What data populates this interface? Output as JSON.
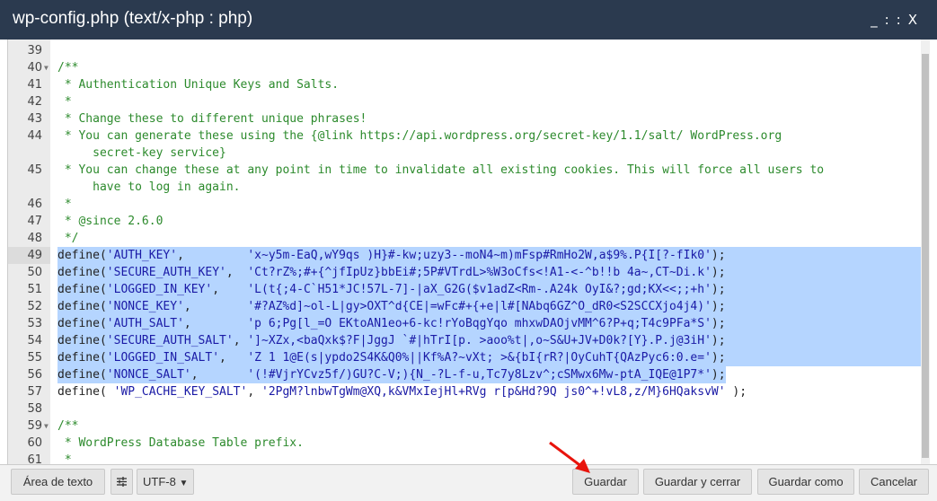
{
  "window": {
    "title": "wp-config.php (text/x-php : php)",
    "controls": [
      "_",
      "::",
      "X"
    ]
  },
  "editor": {
    "selected_lines": [
      49,
      50,
      51,
      52,
      53,
      54,
      55,
      56
    ],
    "current_line": 49,
    "lines": [
      {
        "n": 39,
        "text": ""
      },
      {
        "n": 40,
        "text": "/**",
        "fold": true,
        "comment": true
      },
      {
        "n": 41,
        "text": " * Authentication Unique Keys and Salts.",
        "comment": true
      },
      {
        "n": 42,
        "text": " *",
        "comment": true
      },
      {
        "n": 43,
        "text": " * Change these to different unique phrases!",
        "comment": true
      },
      {
        "n": 44,
        "text": " * You can generate these using the {@link https://api.wordpress.org/secret-key/1.1/salt/ WordPress.org",
        "cont": "     secret-key service}",
        "comment": true
      },
      {
        "n": 45,
        "text": " * You can change these at any point in time to invalidate all existing cookies. This will force all users to",
        "cont": "     have to log in again.",
        "comment": true
      },
      {
        "n": 46,
        "text": " *",
        "comment": true
      },
      {
        "n": 47,
        "text": " * @since 2.6.0",
        "comment": true
      },
      {
        "n": 48,
        "text": " */",
        "comment": true
      },
      {
        "n": 49,
        "text": "define('AUTH_KEY',         'x~y5m-EaQ,wY9qs )H}#-kw;uzy3--moN4~m)mFsp#RmHo2W,a$9%.P{I[?-fIk0');"
      },
      {
        "n": 50,
        "text": "define('SECURE_AUTH_KEY',  'Ct?rZ%;#+{^jfIpUz}bbEi#;5P#VTrdL>%W3oCfs<!A1-<-^b!!b 4a~,CT~Di.k');"
      },
      {
        "n": 51,
        "text": "define('LOGGED_IN_KEY',    'L(t{;4-C`H51*JC!57L-7]-|aX_G2G($v1adZ<Rm-.A24k OyI&?;gd;KX<<;;+h');"
      },
      {
        "n": 52,
        "text": "define('NONCE_KEY',        '#?AZ%d]~ol-L|gy>OXT^d{CE|=wFc#+{+e|l#[NAbq6GZ^O_dR0<S2SCCXjo4j4)');"
      },
      {
        "n": 53,
        "text": "define('AUTH_SALT',        'p 6;Pg[l_=O EKtoAN1eo+6-kc!rYoBqgYqo mhxwDAOjvMM^6?P+q;T4c9PFa*S');"
      },
      {
        "n": 54,
        "text": "define('SECURE_AUTH_SALT', ']~XZx,<baQxk$?F|JggJ `#|hTrI[p. >aoo%t|,o~S&U+JV+D0k?[Y}.P.j@3iH');"
      },
      {
        "n": 55,
        "text": "define('LOGGED_IN_SALT',   'Z 1 1@E(s|ypdo2S4K&Q0%||Kf%A?~vXt; >&{bI{rR?|OyCuhT{QAzPyc6:0.e=');"
      },
      {
        "n": 56,
        "text": "define('NONCE_SALT',       '(!#VjrYCvz5f/)GU?C-V;){N_-?L-f-u,Tc7y8Lzv^;cSMwx6Mw-ptA_IQE@1P7*');"
      },
      {
        "n": 57,
        "text": "define( 'WP_CACHE_KEY_SALT', '2PgM?lnbwTgWm@XQ,k&VMxIejHl+RVg r[p&Hd?9Q js0^+!vL8,z/M}6HQaksvW' );"
      },
      {
        "n": 58,
        "text": ""
      },
      {
        "n": 59,
        "text": "/**",
        "fold": true,
        "comment": true
      },
      {
        "n": 60,
        "text": " * WordPress Database Table prefix.",
        "comment": true
      },
      {
        "n": 61,
        "text": " *",
        "comment": true
      }
    ]
  },
  "footer": {
    "textarea_button": "Área de texto",
    "settings_icon": "sliders-icon",
    "encoding": "UTF-8",
    "save": "Guardar",
    "save_close": "Guardar y cerrar",
    "save_as": "Guardar como",
    "cancel": "Cancelar"
  },
  "annotation": {
    "arrow_color": "#e8140c"
  }
}
